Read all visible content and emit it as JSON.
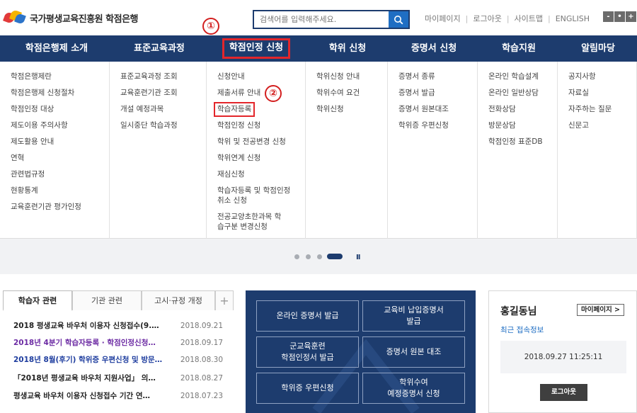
{
  "header": {
    "logo_text": "국가평생교육진흥원 학점은행",
    "search_placeholder": "검색어를 입력해주세요.",
    "util_links": [
      "마이페이지",
      "로그아웃",
      "사이트맵",
      "ENGLISH"
    ],
    "size_buttons": [
      "-",
      "•",
      "+"
    ]
  },
  "annotations": {
    "marker1": "①",
    "marker2": "②"
  },
  "nav": {
    "items": [
      "학점은행제 소개",
      "표준교육과정",
      "학점인정 신청",
      "학위 신청",
      "증명서 신청",
      "학습지원",
      "알림마당"
    ],
    "highlighted_index": 2
  },
  "mega_menu": {
    "columns": [
      [
        "학점은행제란",
        "학점은행제 신청절차",
        "학점인정 대상",
        "제도이용 주의사항",
        "제도활용 안내",
        "연혁",
        "관련법규정",
        "현황통계",
        "교육훈련기관 평가인정"
      ],
      [
        "표준교육과정 조회",
        "교육훈련기관 조회",
        "개설 예정과목",
        "일시중단 학습과정"
      ],
      [
        "신청안내",
        "제출서류 안내",
        "학습자등록",
        "학점인정 신청",
        "학위 및 전공변경 신청",
        "학위연계 신청",
        "재심신청",
        "학습자등록 및 학점인정 취소 신청",
        "전공교양초한과목 학습구분 변경신청"
      ],
      [
        "학위신청 안내",
        "학위수여 요건",
        "학위신청"
      ],
      [
        "증명서 종류",
        "증명서 발급",
        "증명서 원본대조",
        "학위증 우편신청"
      ],
      [
        "온라인 학습설계",
        "온라인 일반상담",
        "전화상담",
        "방문상담",
        "학점인정 표준DB"
      ],
      [
        "공지사항",
        "자료실",
        "자주하는 질문",
        "신문고"
      ]
    ]
  },
  "slider": {
    "pause_label": "II"
  },
  "board": {
    "tabs": [
      "학습자 관련",
      "기관 관련",
      "고시·규정 개정",
      "+"
    ],
    "notices": [
      {
        "title": "2018 평생교육 바우처 이용자 신청접수(9.…",
        "date": "2018.09.21",
        "color": "#222222"
      },
      {
        "title": "2018년 4분기 학습자등록 · 학점인정신청…",
        "date": "2018.09.17",
        "color": "#6b2aa3"
      },
      {
        "title": "2018년 8월(후기) 학위증 우편신청 및 방문…",
        "date": "2018.08.30",
        "color": "#1d3c9e"
      },
      {
        "title": "「2018년 평생교육 바우처 지원사업」 의…",
        "date": "2018.08.27",
        "color": "#222222"
      },
      {
        "title": "평생교육 바우처 이용자 신청접수 기간 연…",
        "date": "2018.07.23",
        "color": "#222222"
      }
    ]
  },
  "services": [
    "온라인 증명서 발급",
    "교육비 납입증명서\n발급",
    "군교육훈련\n학점인정서 발급",
    "증명서 원본 대조",
    "학위증 우편신청",
    "학위수여\n예정증명서 신청"
  ],
  "user": {
    "name": "홍길동님",
    "mypage_label": "마이페이지 >",
    "recent_label": "최근 접속정보",
    "last_login": "2018.09.27 11:25:11",
    "logout_label": "로그아웃"
  },
  "colors": {
    "primary": "#1d3c6e",
    "highlight": "#e3262b",
    "search_button": "#1f6ec3"
  }
}
